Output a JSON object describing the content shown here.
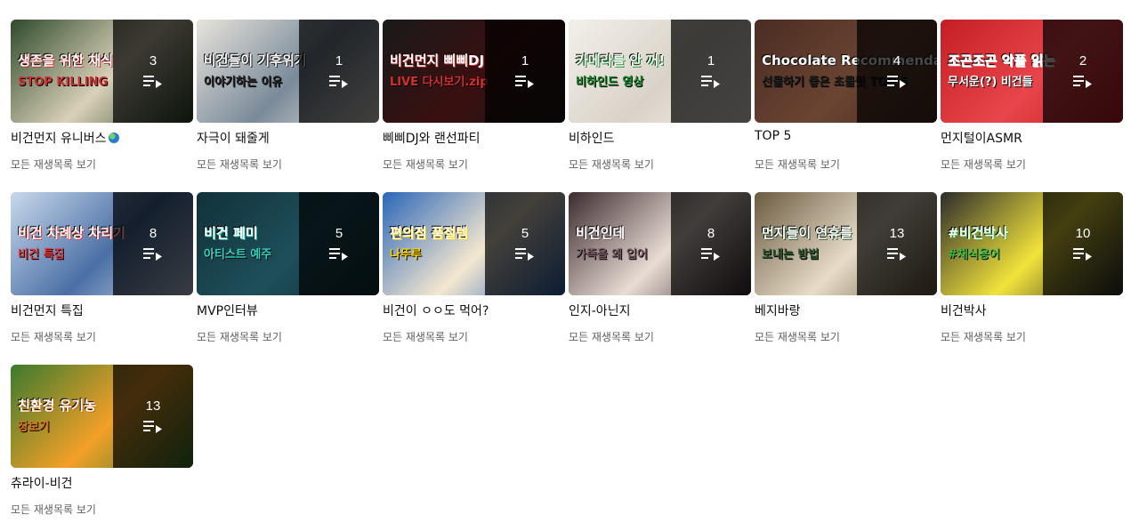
{
  "colors": {
    "title_text": "#0f0f0f",
    "sub_text": "#606060",
    "overlay": "rgba(0,0,0,0.72)"
  },
  "playlists": [
    {
      "title": "비건먼지 유니버스",
      "title_icon": "globe-emoji",
      "count": "3",
      "sub": "모든 재생목록 보기",
      "thumb_text": "생존을 위한 채식",
      "thumb_text2": "STOP KILLING",
      "thumb_colors": [
        "#2e4a2a",
        "#d9d0b8",
        "#c93030"
      ]
    },
    {
      "title": "자극이 돼줄게",
      "count": "1",
      "sub": "모든 재생목록 보기",
      "thumb_text": "비건들이 기후위기",
      "thumb_text2": "이야기하는 이유",
      "thumb_colors": [
        "#e8e4dc",
        "#7a8a9a",
        "#2a2a2a"
      ]
    },
    {
      "title": "삐삐DJ와 랜선파티",
      "count": "1",
      "sub": "모든 재생목록 보기",
      "thumb_text": "비건먼지 삐삐DJ",
      "thumb_text2": "LIVE 다시보기.zip",
      "thumb_colors": [
        "#1a1a1a",
        "#3a0f10",
        "#d32f2f"
      ]
    },
    {
      "title": "비하인드",
      "count": "1",
      "sub": "모든 재생목록 보기",
      "thumb_text": "카메라를 안 꺼!",
      "thumb_text2": "비하인드 영상",
      "thumb_colors": [
        "#f3f0ea",
        "#d9d2c8",
        "#1b8a2a"
      ]
    },
    {
      "title": "TOP 5",
      "count": "4",
      "sub": "모든 재생목록 보기",
      "thumb_text": "Chocolate Recommendation",
      "thumb_text2": "선물하기 좋은 초콜릿 TOP 5",
      "thumb_colors": [
        "#4a2d22",
        "#6b4432",
        "#23201f"
      ]
    },
    {
      "title": "먼지털이ASMR",
      "count": "2",
      "sub": "모든 재생목록 보기",
      "thumb_text": "조곤조곤 악플 읽는",
      "thumb_text2": "무서운(?) 비건들",
      "thumb_colors": [
        "#c41e24",
        "#e8464c",
        "#ffffff"
      ]
    },
    {
      "title": "비건먼지 특집",
      "count": "8",
      "sub": "모든 재생목록 보기",
      "thumb_text": "비건 차례상 차리기",
      "thumb_text2": "비건 특집",
      "thumb_colors": [
        "#c9d9ec",
        "#4a6fa5",
        "#e33d3d"
      ]
    },
    {
      "title": "MVP인터뷰",
      "count": "5",
      "sub": "모든 재생목록 보기",
      "thumb_text": "비건 페미",
      "thumb_text2": "아티스트 예주",
      "thumb_colors": [
        "#11313a",
        "#1e4f5a",
        "#36d2c0"
      ]
    },
    {
      "title": "비건이 ㅇㅇ도 먹어?",
      "count": "5",
      "sub": "모든 재생목록 보기",
      "thumb_text": "편의점 품절템",
      "thumb_text2": "나뚜루",
      "thumb_colors": [
        "#2a66b8",
        "#f4e7d0",
        "#ffd200"
      ]
    },
    {
      "title": "인지-아닌지",
      "count": "8",
      "sub": "모든 재생목록 보기",
      "thumb_text": "비건인데",
      "thumb_text2": "가족을 왜 입어",
      "thumb_colors": [
        "#3c2b2f",
        "#e8dcd4",
        "#7a5c66"
      ]
    },
    {
      "title": "베지바랑",
      "count": "13",
      "sub": "모든 재생목록 보기",
      "thumb_text": "먼지들이 연휴를",
      "thumb_text2": "보내는 방법",
      "thumb_colors": [
        "#6a5a40",
        "#e8dcc8",
        "#2f5a2f"
      ]
    },
    {
      "title": "비건박사",
      "count": "10",
      "sub": "모든 재생목록 보기",
      "thumb_text": "#비건박사",
      "thumb_text2": "#채식용어",
      "thumb_colors": [
        "#2c2c2c",
        "#f2e33a",
        "#3fbf3f"
      ]
    },
    {
      "title": "츄라이-비건",
      "count": "13",
      "sub": "모든 재생목록 보기",
      "thumb_text": "친환경 유기농",
      "thumb_text2": "장보기",
      "thumb_colors": [
        "#3a7a2e",
        "#f3a028",
        "#d86a12"
      ]
    }
  ]
}
